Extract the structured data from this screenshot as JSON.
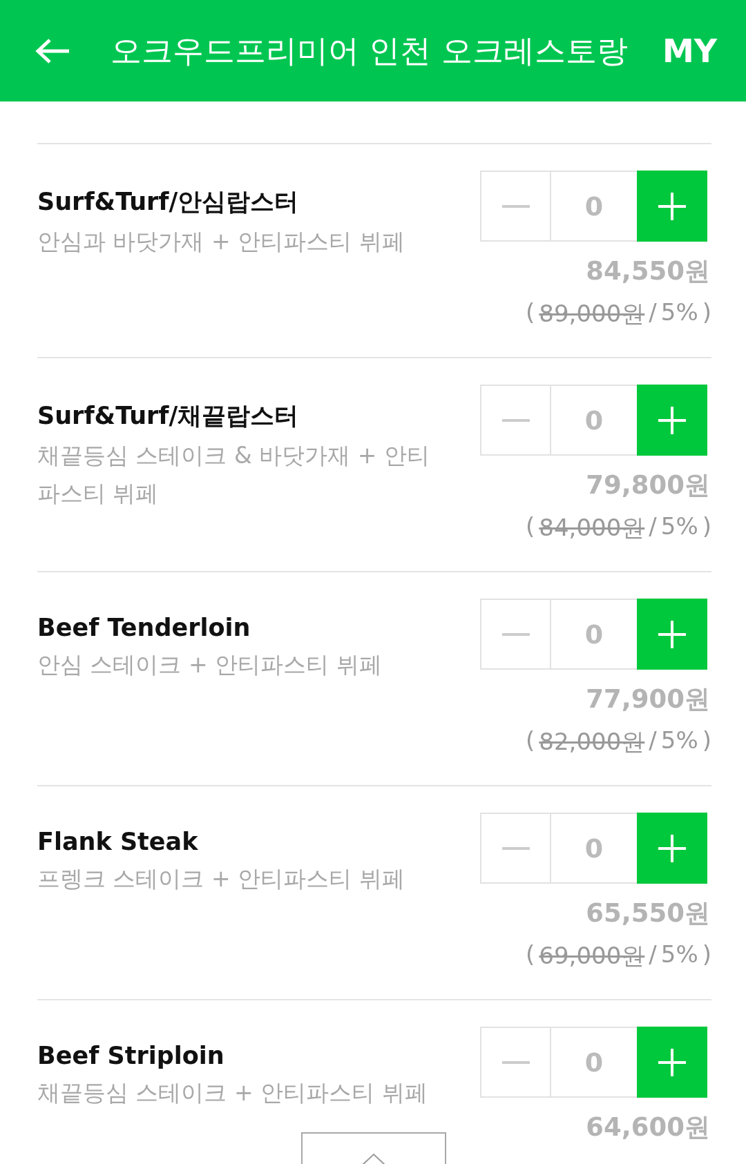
{
  "header": {
    "title": "오크우드프리미어 인천 오크레스토랑",
    "my_link": "MY"
  },
  "items": [
    {
      "title": "Surf&Turf/안심랍스터",
      "description": "안심과 바닷가재 + 안티파스티 뷔페",
      "quantity": "0",
      "minus_disabled": true,
      "price": "84,550원",
      "note_open": "(",
      "original_price": "89,000원",
      "note_separator": "/",
      "discount": "5%",
      "note_close": ")"
    },
    {
      "title": "Surf&Turf/채끝랍스터",
      "description": "채끝등심 스테이크 & 바닷가재 + 안티파스티 뷔페",
      "quantity": "0",
      "minus_disabled": true,
      "price": "79,800원",
      "note_open": "(",
      "original_price": "84,000원",
      "note_separator": "/",
      "discount": "5%",
      "note_close": ")"
    },
    {
      "title": "Beef Tenderloin",
      "description": "안심 스테이크 + 안티파스티 뷔페",
      "quantity": "0",
      "minus_disabled": true,
      "price": "77,900원",
      "note_open": "(",
      "original_price": "82,000원",
      "note_separator": "/",
      "discount": "5%",
      "note_close": ")"
    },
    {
      "title": "Flank Steak",
      "description": "프렝크 스테이크 + 안티파스티 뷔페",
      "quantity": "0",
      "minus_disabled": true,
      "price": "65,550원",
      "note_open": "(",
      "original_price": "69,000원",
      "note_separator": "/",
      "discount": "5%",
      "note_close": ")"
    },
    {
      "title": "Beef Striploin",
      "description": "채끝등심 스테이크 + 안티파스티 뷔페",
      "quantity": "0",
      "minus_disabled": true,
      "price": "64,600원"
    }
  ]
}
